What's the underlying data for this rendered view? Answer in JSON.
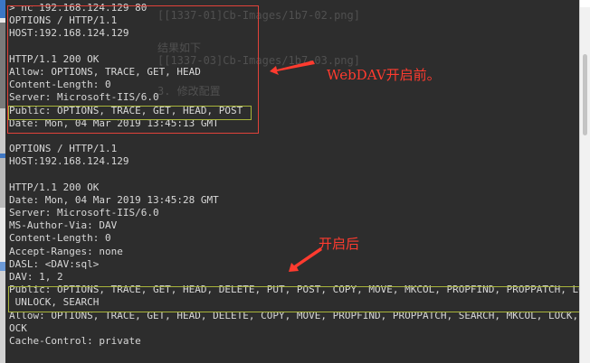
{
  "terminal": {
    "lines": [
      "> nc 192.168.124.129 80",
      "OPTIONS / HTTP/1.1",
      "HOST:192.168.124.129",
      "",
      "HTTP/1.1 200 OK",
      "Allow: OPTIONS, TRACE, GET, HEAD",
      "Content-Length: 0",
      "Server: Microsoft-IIS/6.0",
      "Public: OPTIONS, TRACE, GET, HEAD, POST",
      "Date: Mon, 04 Mar 2019 13:45:13 GMT",
      "",
      "OPTIONS / HTTP/1.1",
      "HOST:192.168.124.129",
      "",
      "HTTP/1.1 200 OK",
      "Date: Mon, 04 Mar 2019 13:45:28 GMT",
      "Server: Microsoft-IIS/6.0",
      "MS-Author-Via: DAV",
      "Content-Length: 0",
      "Accept-Ranges: none",
      "DASL: <DAV:sql>",
      "DAV: 1, 2",
      "Public: OPTIONS, TRACE, GET, HEAD, DELETE, PUT, POST, COPY, MOVE, MKCOL, PROPFIND, PROPPATCH, LOCK,",
      " UNLOCK, SEARCH",
      "Allow: OPTIONS, TRACE, GET, HEAD, DELETE, COPY, MOVE, PROPFIND, PROPPATCH, SEARCH, MKCOL, LOCK, UNL",
      "OCK",
      "Cache-Control: private"
    ]
  },
  "annotations": {
    "before": "WebDAV开启前。",
    "after": "开启后"
  },
  "colors": {
    "terminal_bg": "#2d2d2d",
    "terminal_text": "#d8d8d8",
    "annotation": "#ff3b2f",
    "box_red": "#e0423a",
    "box_olive": "#a8b43a"
  }
}
